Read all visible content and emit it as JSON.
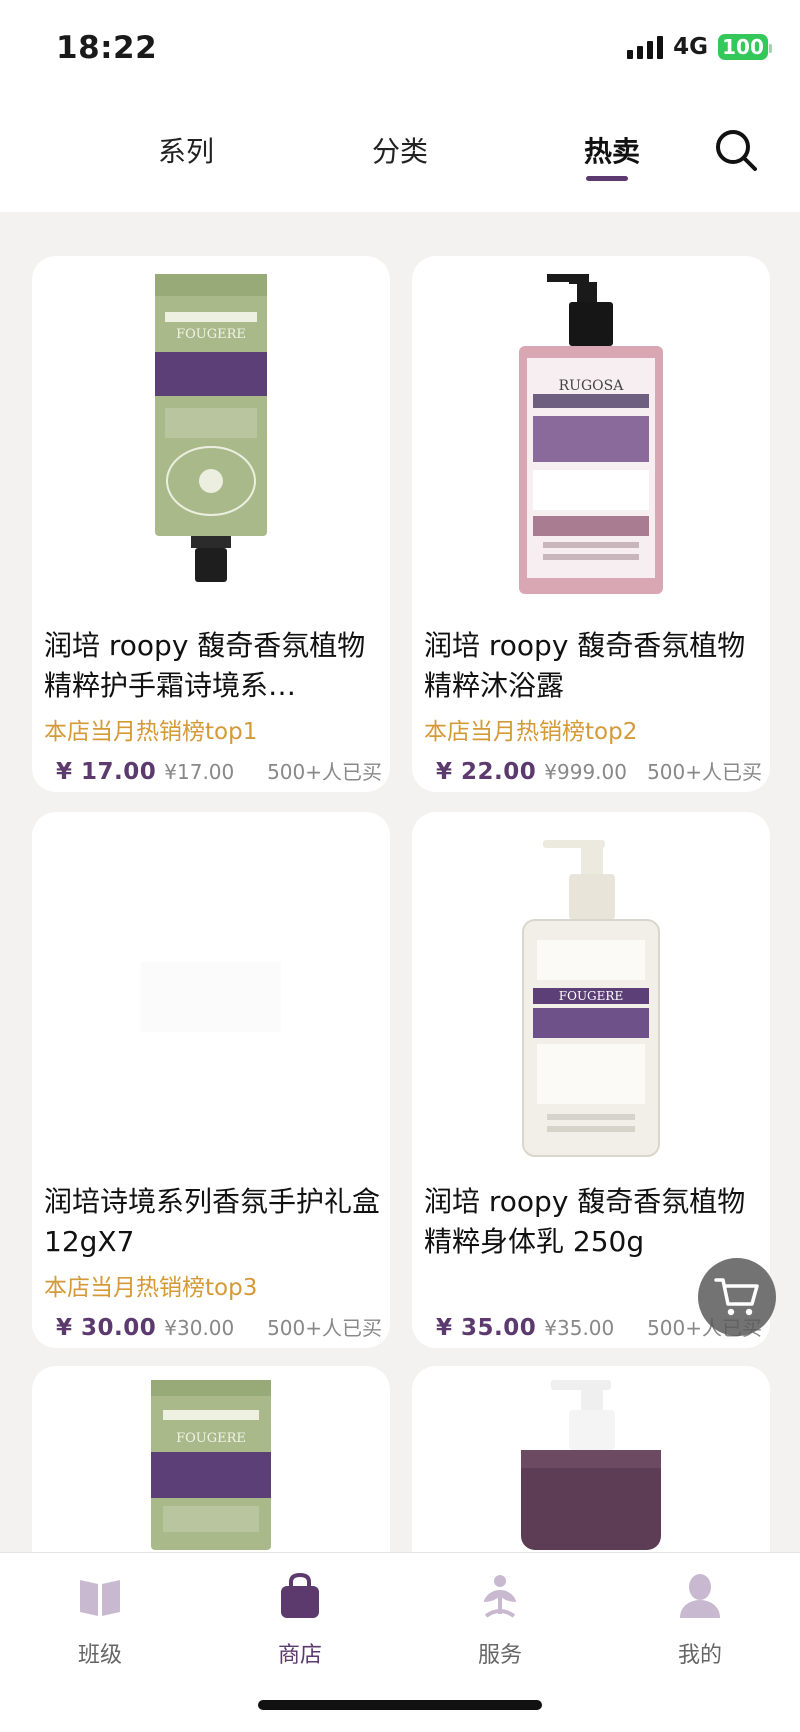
{
  "status_bar": {
    "time": "18:22",
    "network": "4G",
    "battery": "100"
  },
  "tabs": [
    {
      "label": "系列",
      "active": false
    },
    {
      "label": "分类",
      "active": false
    },
    {
      "label": "热卖",
      "active": true
    }
  ],
  "products": [
    {
      "title": "润培 roopy 馥奇香氛植物精粹护手霜诗境系…",
      "tag": "本店当月热销榜top1",
      "price": "¥ 17.00",
      "original_price": "¥17.00",
      "sold": "500+人已买",
      "image": "hand-cream-tube",
      "label": "FOUGERE"
    },
    {
      "title": "润培 roopy 馥奇香氛植物精粹沐浴露",
      "tag": "本店当月热销榜top2",
      "price": "¥ 22.00",
      "original_price": "¥999.00",
      "sold": "500+人已买",
      "image": "bath-gel-bottle",
      "label": "RUGOSA"
    },
    {
      "title": "润培诗境系列香氛手护礼盒 12gX7",
      "tag": "本店当月热销榜top3",
      "price": "¥ 30.00",
      "original_price": "¥30.00",
      "sold": "500+人已买",
      "image": "gift-box-blank"
    },
    {
      "title": "润培 roopy 馥奇香氛植物精粹身体乳 250g",
      "tag": "",
      "price": "¥ 35.00",
      "original_price": "¥35.00",
      "sold": "500+人已买",
      "image": "body-lotion-bottle",
      "label": "FOUGERE"
    },
    {
      "title": "",
      "image": "hand-cream-tube-green",
      "label": "FOUGERE"
    },
    {
      "title": "",
      "image": "purple-pump-bottle"
    }
  ],
  "bottom_nav": [
    {
      "label": "班级",
      "icon": "book-icon",
      "active": false
    },
    {
      "label": "商店",
      "icon": "bag-icon",
      "active": true
    },
    {
      "label": "服务",
      "icon": "lotus-icon",
      "active": false
    },
    {
      "label": "我的",
      "icon": "person-icon",
      "active": false
    }
  ],
  "colors": {
    "accent": "#5c3a6e",
    "tag": "#d49a38",
    "background": "#f3f2f1"
  }
}
